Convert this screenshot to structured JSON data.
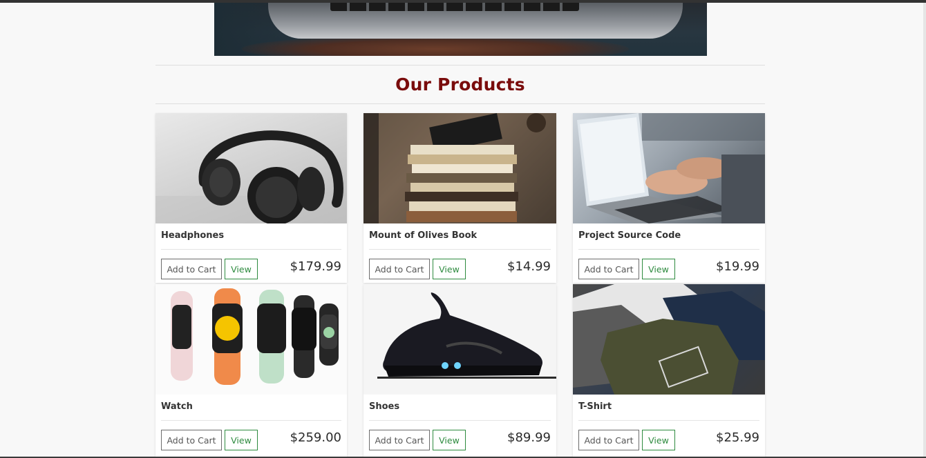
{
  "section": {
    "title": "Our Products"
  },
  "products": [
    {
      "name": "Headphones",
      "price": "$179.99",
      "cart_label": "Add to Cart",
      "view_label": "View"
    },
    {
      "name": "Mount of Olives Book",
      "price": "$14.99",
      "cart_label": "Add to Cart",
      "view_label": "View"
    },
    {
      "name": "Project Source Code",
      "price": "$19.99",
      "cart_label": "Add to Cart",
      "view_label": "View"
    },
    {
      "name": "Watch",
      "price": "$259.00",
      "cart_label": "Add to Cart",
      "view_label": "View"
    },
    {
      "name": "Shoes",
      "price": "$89.99",
      "cart_label": "Add to Cart",
      "view_label": "View"
    },
    {
      "name": "T-Shirt",
      "price": "$25.99",
      "cart_label": "Add to Cart",
      "view_label": "View"
    }
  ],
  "colors": {
    "title": "#7a0c0c",
    "view_button": "#2d8a3e",
    "cart_button_border": "#6c6c6c"
  }
}
